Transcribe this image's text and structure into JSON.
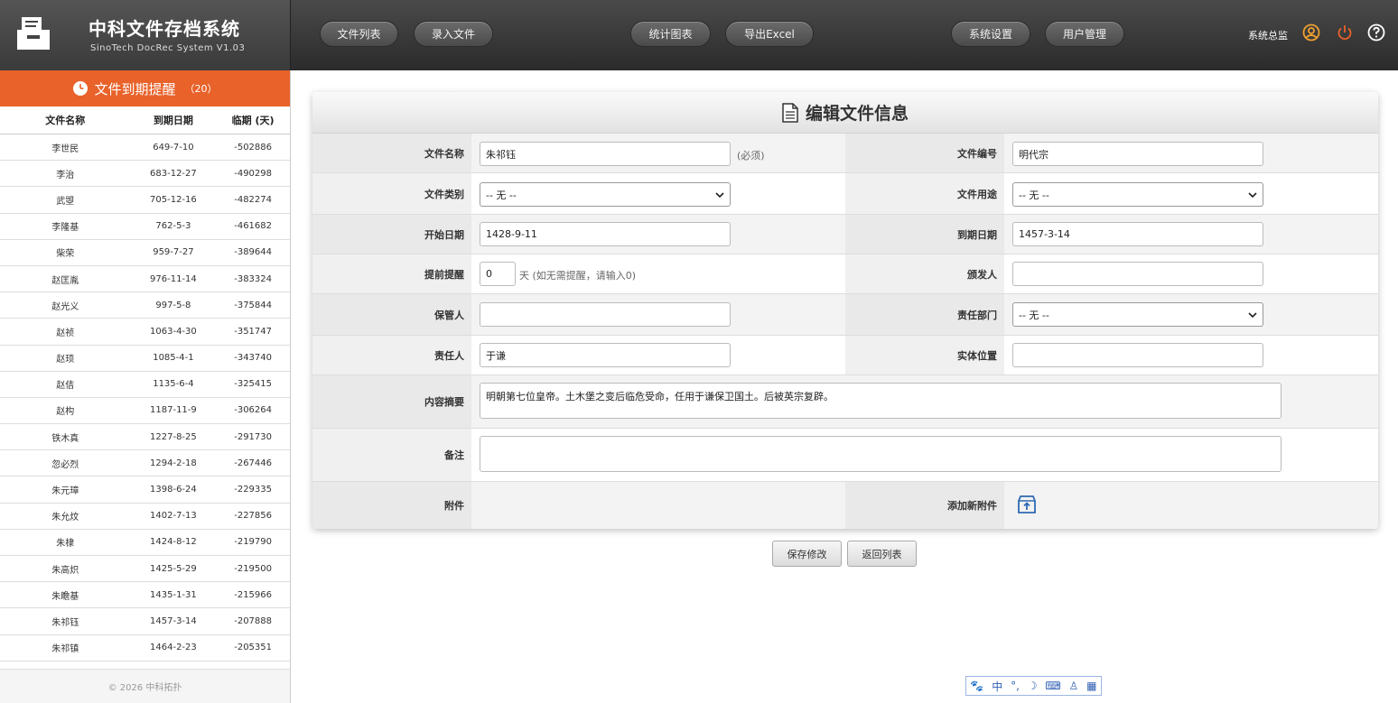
{
  "brand": {
    "title": "中科文件存档系统",
    "subtitle": "SinoTech DocRec System V1.03"
  },
  "nav": {
    "file_list": "文件列表",
    "add_file": "录入文件",
    "charts": "统计图表",
    "export": "导出Excel",
    "settings": "系统设置",
    "users": "用户管理"
  },
  "user": {
    "name": "系统总监"
  },
  "sidebar": {
    "title": "文件到期提醒",
    "count": "（20）",
    "columns": [
      "文件名称",
      "到期日期",
      "临期 (天)"
    ],
    "rows": [
      [
        "李世民",
        "649-7-10",
        "-502886"
      ],
      [
        "李治",
        "683-12-27",
        "-490298"
      ],
      [
        "武曌",
        "705-12-16",
        "-482274"
      ],
      [
        "李隆基",
        "762-5-3",
        "-461682"
      ],
      [
        "柴荣",
        "959-7-27",
        "-389644"
      ],
      [
        "赵匡胤",
        "976-11-14",
        "-383324"
      ],
      [
        "赵光义",
        "997-5-8",
        "-375844"
      ],
      [
        "赵祯",
        "1063-4-30",
        "-351747"
      ],
      [
        "赵顼",
        "1085-4-1",
        "-343740"
      ],
      [
        "赵佶",
        "1135-6-4",
        "-325415"
      ],
      [
        "赵构",
        "1187-11-9",
        "-306264"
      ],
      [
        "铁木真",
        "1227-8-25",
        "-291730"
      ],
      [
        "忽必烈",
        "1294-2-18",
        "-267446"
      ],
      [
        "朱元璋",
        "1398-6-24",
        "-229335"
      ],
      [
        "朱允炆",
        "1402-7-13",
        "-227856"
      ],
      [
        "朱棣",
        "1424-8-12",
        "-219790"
      ],
      [
        "朱高炽",
        "1425-5-29",
        "-219500"
      ],
      [
        "朱瞻基",
        "1435-1-31",
        "-215966"
      ],
      [
        "朱祁钰",
        "1457-3-14",
        "-207888"
      ],
      [
        "朱祁镇",
        "1464-2-23",
        "-205351"
      ]
    ],
    "footer": "© 2026 中科拓扑"
  },
  "form": {
    "title": "编辑文件信息",
    "labels": {
      "name": "文件名称",
      "number": "文件编号",
      "category": "文件类别",
      "purpose": "文件用途",
      "start": "开始日期",
      "end": "到期日期",
      "remind": "提前提醒",
      "issuer": "颁发人",
      "keeper": "保管人",
      "dept": "责任部门",
      "owner": "责任人",
      "location": "实体位置",
      "summary": "内容摘要",
      "remark": "备注",
      "attach": "附件",
      "add_attach": "添加新附件"
    },
    "values": {
      "name": "朱祁钰",
      "name_note": "(必须)",
      "number": "明代宗",
      "category": "-- 无 --",
      "purpose": "-- 无 --",
      "start": "1428-9-11",
      "end": "1457-3-14",
      "remind": "0",
      "remind_note": "天 (如无需提醒，请输入0)",
      "issuer": "",
      "keeper": "",
      "dept": "-- 无 --",
      "owner": "于谦",
      "location": "",
      "summary": "明朝第七位皇帝。土木堡之变后临危受命，任用于谦保卫国土。后被英宗复辟。",
      "remark": ""
    },
    "buttons": {
      "save": "保存修改",
      "back": "返回列表"
    }
  },
  "ime": {
    "lang": "中"
  }
}
